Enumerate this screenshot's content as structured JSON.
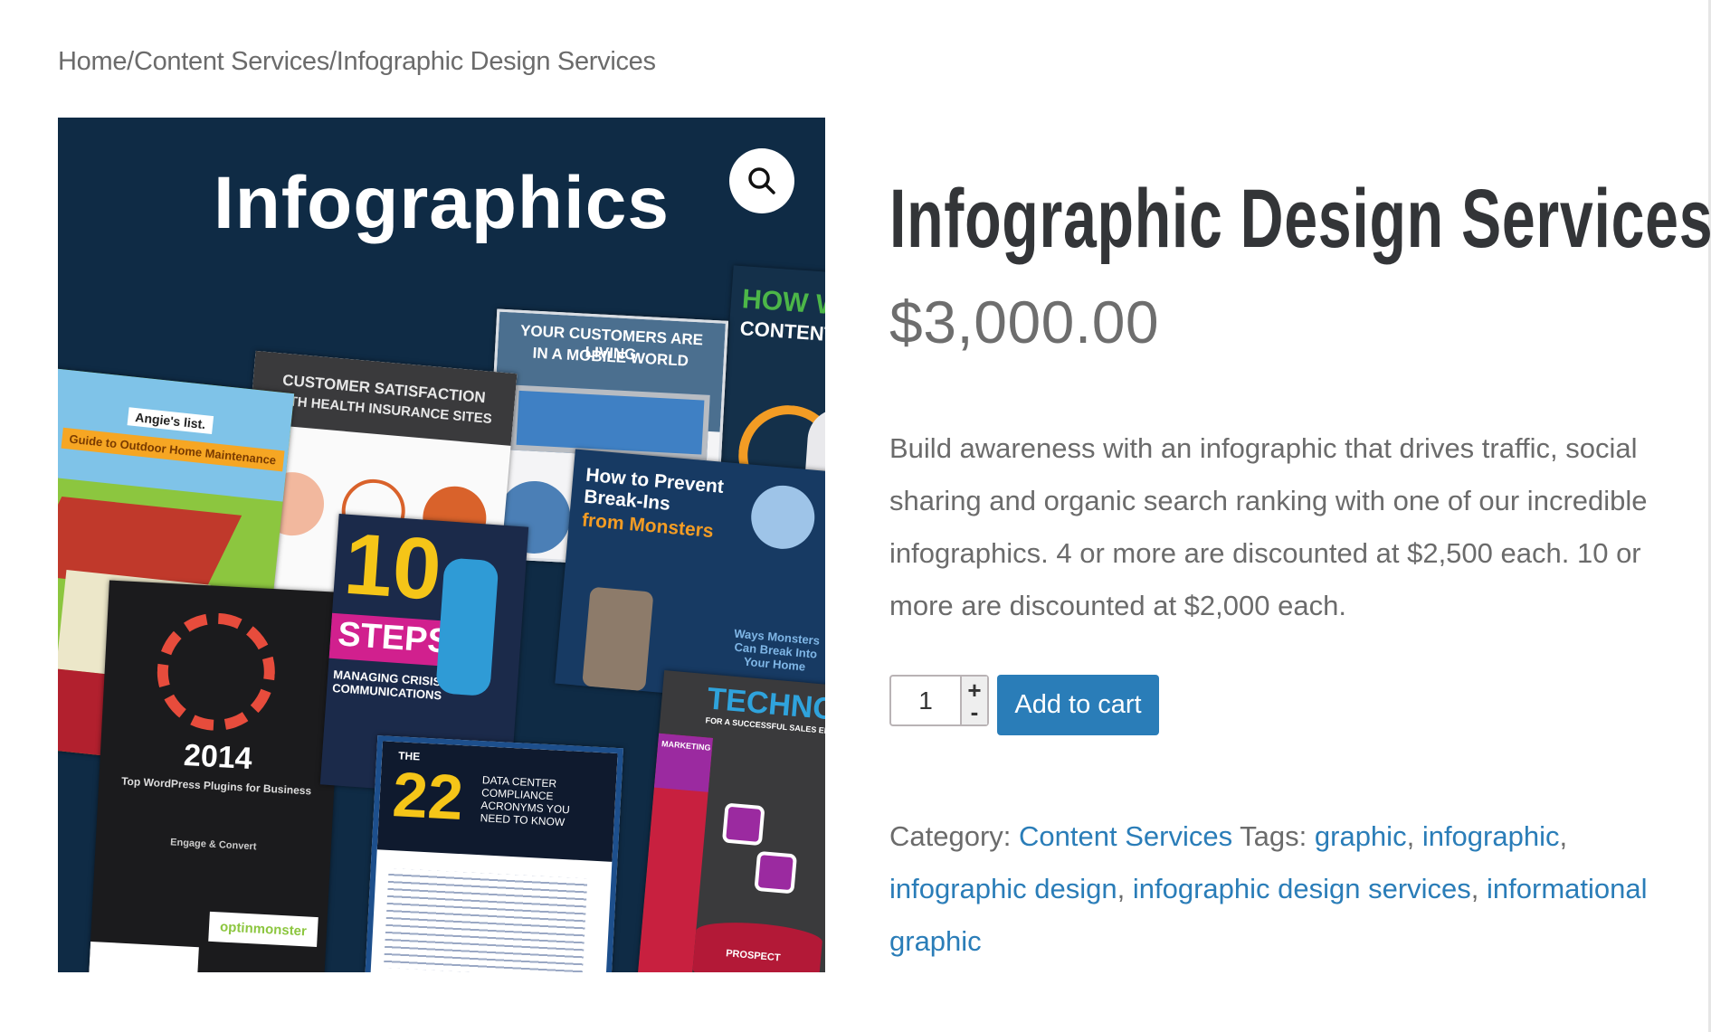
{
  "breadcrumb": {
    "items": [
      "Home",
      "Content Services",
      "Infographic Design Services"
    ],
    "separator": "/"
  },
  "gallery": {
    "heading": "Infographics",
    "zoom_icon": "magnifier-icon",
    "background": "#0f2b45",
    "cards": [
      {
        "title": "Angie's list.",
        "subtitle": "Guide to Outdoor Home Maintenance"
      },
      {
        "title": "CUSTOMER SATISFACTION",
        "subtitle": "WITH HEALTH INSURANCE SITES"
      },
      {
        "title": "YOUR CUSTOMERS ARE LIVING",
        "subtitle": "IN A MOBILE WORLD"
      },
      {
        "title": "HOW WE",
        "subtitle": "CONTENT FR"
      },
      {
        "title": "How to Prevent Break-Ins",
        "subtitle": "from Monsters"
      },
      {
        "title": "10",
        "subtitle": "STEPS",
        "caption": "MANAGING CRISIS COMMUNICATIONS"
      },
      {
        "title": "2014",
        "subtitle": "Top WordPress Plugins for Business",
        "caption": "Engage & Convert",
        "brand": "optinmonster"
      },
      {
        "title": "22",
        "subtitle": "DATA CENTER COMPLIANCE ACRONYMS YOU NEED TO KNOW",
        "pre": "THE"
      },
      {
        "title": "TECHNOLOG",
        "subtitle": "FOR A SUCCESSFUL SALES ENABLEMENT",
        "caption": "PROSPECT",
        "label": "MARKETING"
      },
      {
        "title": "Ways Monsters Can Break Into Your Home"
      }
    ]
  },
  "product": {
    "title": "Infographic Design Services",
    "price": "$3,000.00",
    "description": "Build awareness with an infographic that drives traffic, social sharing and organic search ranking with one of our incredible infographics. 4 or more are discounted at $2,500 each. 10 or more are discounted at $2,000 each.",
    "quantity": "1",
    "increment_label": "+",
    "decrement_label": "-",
    "add_to_cart_label": "Add to cart",
    "category_label": "Category:",
    "category": "Content Services",
    "tags_label": "Tags:",
    "tags": [
      "graphic",
      "infographic",
      "infographic design",
      "infographic design services",
      "informational graphic"
    ]
  },
  "colors": {
    "link": "#2a7db8",
    "button": "#2a7db8",
    "text": "#6b6b6b",
    "title": "#333538"
  }
}
